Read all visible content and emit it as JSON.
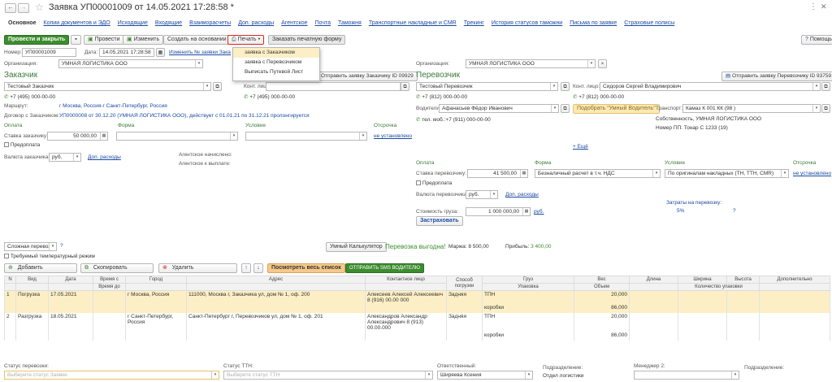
{
  "window": {
    "title": "Заявка УП00001009 от 14.05.2021 17:28:58 *",
    "back": "←",
    "forward": "→",
    "star": "☆",
    "more": "⋮",
    "close": "✕"
  },
  "tabs": [
    "Основное",
    "Копии документов и ЭДО",
    "Исходящие",
    "Входящие",
    "Взаиморасчеты",
    "Доп. расходы",
    "Агентское",
    "Почта",
    "Таможня",
    "Транспортные накладные и CMR",
    "Трекинг",
    "История статусов таможни",
    "Письма по заявке",
    "Страховые полисы"
  ],
  "toolbar": {
    "post_close": "Провести и закрыть",
    "post": "Провести",
    "edit": "Изменить",
    "create_based": "Создать на основании",
    "print": "Печать",
    "order_print": "Заказать печатную форму",
    "help": "Помощь"
  },
  "print_menu": [
    "заявка с Заказчиком",
    "заявка с Перевозчиком",
    "Выписать Путевой Лист"
  ],
  "header": {
    "number_label": "Номер:",
    "number": "УП00001009",
    "date_label": "Дата:",
    "date": "14.05.2021 17:28:58",
    "change_link": "Изменить № заявки Заказчика"
  },
  "customer": {
    "org_label": "Организация:",
    "org": "УМНАЯ ЛОГИСТИКА ООО",
    "title": "Заказчик",
    "send_btn": "Отправить заявку Заказчику ID 09929",
    "name": "Тестовый Заказчик",
    "contact_label": "Конт. лицо:",
    "phone1": "+7 (495) 000-00-00",
    "phone2": "+7 (495) 000-00-00",
    "route_label": "Маршрут:",
    "route": "г Москва, Россия-г Санкт-Петербург, Россия",
    "contract_label": "Договор с Заказчиком:",
    "contract": "УП0000008 от 30.12.20 (УМНАЯ ЛОГИСТИКА ООО), действует с 01.01.21 по 31.12.21 пролонгируется",
    "pay_label": "Оплата",
    "form_label": "Форма",
    "cond_label": "Условие",
    "delay_label": "Отсрочка",
    "rate_label": "Ставка заказчику:",
    "rate": "50 000,00",
    "not_set": "не установлено",
    "prepay": "Предоплата",
    "currency_label": "Валюта заказчика:",
    "currency": "руб.",
    "extra_link": "Доп. расходы",
    "agent_charged": "Агентское начислено:",
    "agent_paid": "Агентское к выплате:"
  },
  "carrier": {
    "org_label": "Организация:",
    "org": "УМНАЯ ЛОГИСТИКА ООО",
    "title": "Перевозчик",
    "send_btn": "Отправить заявку Перевозчику ID 93759",
    "name": "Тестовый Перевозчик",
    "contact_label": "Конт. лицо:",
    "contact": "Сидоров Сергей Владимирович",
    "phone1": "+7 (812) 000-00-00",
    "phone2": "+7 (812) 000-00-00",
    "drivers_label": "Водители:",
    "driver": "Афанасьев Фёдор Иванович",
    "pick_driver": "Подобрать \"Умный Водитель\"",
    "transport_label": "Транспорт:",
    "transport": "Камаз  К 001 КК (98 )",
    "driver_phone": "тел. моб.:+7 (911) 000-00-00",
    "own": "Собственность, УМНАЯ ЛОГИСТИКА ООО",
    "trailer": "Номер ПП: Тонар С 1233 (19)",
    "add_link": "+ Ещё",
    "pay_label": "Оплата",
    "form_label": "Форма",
    "cond_label": "Условие",
    "delay_label": "Отсрочка",
    "rate_label": "Ставка перевозчику:",
    "rate": "41 500,00",
    "form": "Безналичный расчет в т.ч. НДС",
    "cond": "По оригиналам накладных (ТН, ТТН, CMR)",
    "not_set": "не установлено",
    "prepay": "Предоплата",
    "currency_label": "Валюта перевозчика:",
    "currency": "руб.",
    "extra_link": "Доп. расходы",
    "cargo_cost_label": "Стоимость груза:",
    "cargo_cost": "1 000 000,00",
    "cargo_cur": "руб.",
    "insure_btn": "Застраховать",
    "costs_label": "Затраты на перевозку:",
    "costs": "5%",
    "q": "?"
  },
  "middle": {
    "type": "Сложная перевозка",
    "q": "?",
    "calc": "Умный Калькулятор",
    "profit_text": "Перевозка выгодна!",
    "margin_label": "Маржа:",
    "margin": "8 500,00",
    "profit_label": "Прибыль:",
    "profit": "3 400,00",
    "temp": "Требуемый температурный режим"
  },
  "table_toolbar": {
    "add": "Добавить",
    "copy": "Скопировать",
    "delete": "Удалить",
    "view_all": "Посмотреть весь список",
    "sms": "ОТПРАВИТЬ SMS ВОДИТЕЛЮ"
  },
  "table": {
    "headers": [
      "N",
      "Вид",
      "Дата",
      "Время с",
      "Город",
      "Адрес",
      "Контактное лицо",
      "Способ погрузки",
      "Груз",
      "Вес",
      "Длина",
      "Ширина",
      "Высота",
      "Дополнительно"
    ],
    "subheaders": {
      "time_to": "Время до",
      "pack": "Упаковка",
      "volume": "Объем",
      "pack_qty": "Количество упаковки"
    },
    "rows": [
      {
        "n": "1",
        "kind": "Погрузка",
        "date": "17.05.2021",
        "city": "г Москва, Россия",
        "addr": "111000, Москва г, Заказчика ул, дом № 1, оф. 200",
        "contact": "Алексеев Алексей Алексеевич 8 (916) 00.00 000",
        "method": "Задняя",
        "cargo": "ТПН",
        "pack": "коробки",
        "weight": "20,000",
        "volume": "86,000"
      },
      {
        "n": "2",
        "kind": "Разгрузка",
        "date": "18.05.2021",
        "city": "г Санкт-Петербург, Россия",
        "addr": "Санкт-Петербург г, Перевозчиков ул, дом № 1, оф. 201",
        "contact": "Александров Александр Александрович 8 (913) 00.00.000",
        "method": "Задняя",
        "cargo": "ТПН",
        "pack": "коробки",
        "weight": "20,000",
        "volume": "86,000"
      }
    ]
  },
  "footer": {
    "status_label": "Статус перевозки:",
    "status_ph": "Выберите статус Заявки",
    "ttn_label": "Статус ТТН:",
    "ttn_ph": "Выберите статус ТТН",
    "resp_label": "Ответственный:",
    "resp": "Ширяева Ксения",
    "dept_label": "Подразделение:",
    "dept": "Отдел логистики",
    "mgr_label": "Менеджер 2:",
    "dept2_label": "Подразделение:"
  },
  "colors": {
    "accent_green": "#3d8c2f",
    "link": "#1a4aa0",
    "selected": "#fcefc5",
    "print_highlight": "#d9261c"
  }
}
